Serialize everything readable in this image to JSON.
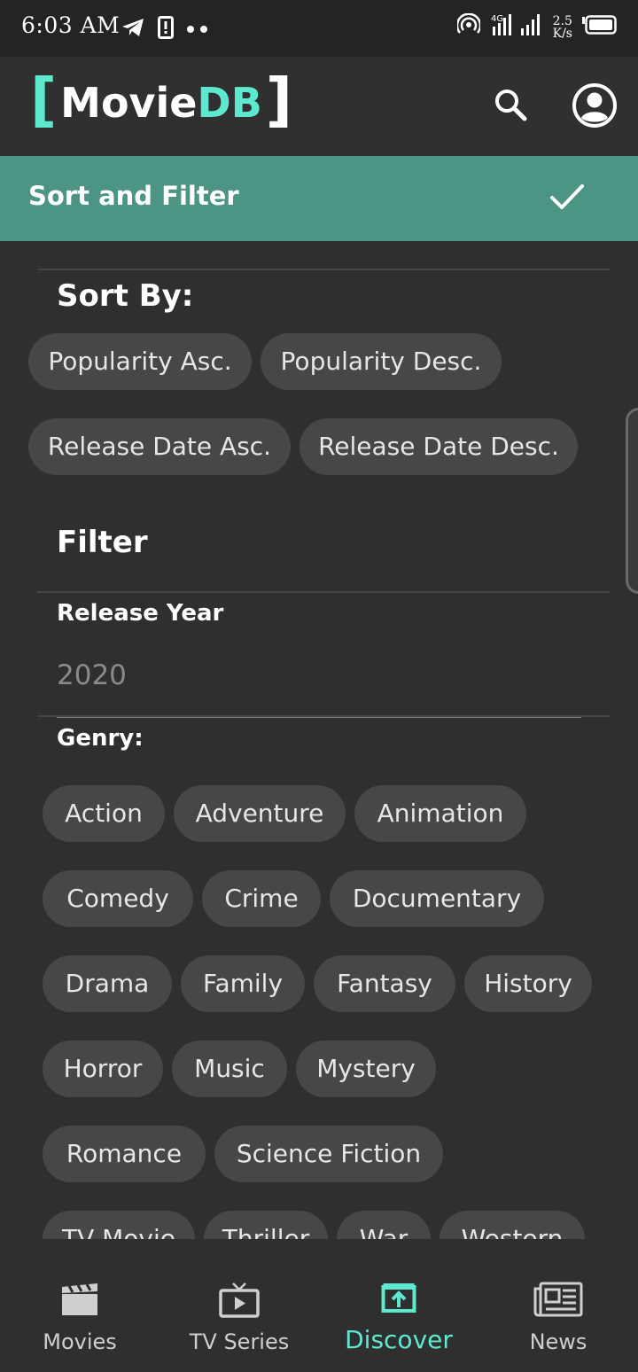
{
  "status_bar": {
    "time": "6:03 AM",
    "net_speed_value": "2.5",
    "net_speed_unit": "K/s",
    "network_type": "4G",
    "icons": [
      "telegram-icon",
      "sim-icon",
      "dots-icon",
      "hotspot-icon",
      "signal-icon",
      "battery-icon"
    ]
  },
  "app_bar": {
    "logo_open": "[",
    "logo_movie": "Movie",
    "logo_db": "DB",
    "logo_close": "]",
    "icons": [
      "search-icon",
      "account-icon"
    ]
  },
  "filter_bar": {
    "title": "Sort and Filter",
    "icon": "check-icon"
  },
  "sort": {
    "heading": "Sort By:",
    "options": [
      "Popularity Asc.",
      "Popularity Desc.",
      "Release Date Asc.",
      "Release Date Desc."
    ]
  },
  "filter": {
    "heading": "Filter",
    "release_year_label": "Release Year",
    "release_year_value": "2020",
    "genre_label": "Genry:",
    "genres": [
      "Action",
      "Adventure",
      "Animation",
      "Comedy",
      "Crime",
      "Documentary",
      "Drama",
      "Family",
      "Fantasy",
      "History",
      "Horror",
      "Music",
      "Mystery",
      "Romance",
      "Science Fiction",
      "TV Movie",
      "Thriller",
      "War",
      "Western"
    ]
  },
  "bottom_nav": {
    "items": [
      {
        "label": "Movies",
        "icon": "clapperboard-icon"
      },
      {
        "label": "TV Series",
        "icon": "tv-icon"
      },
      {
        "label": "Discover",
        "icon": "discover-icon"
      },
      {
        "label": "News",
        "icon": "newspaper-icon"
      }
    ],
    "active": "Discover"
  },
  "colors": {
    "accent": "#5ee8cf",
    "filter_bar": "#4c9483",
    "background": "#2f2f2f",
    "chip": "#474747"
  }
}
